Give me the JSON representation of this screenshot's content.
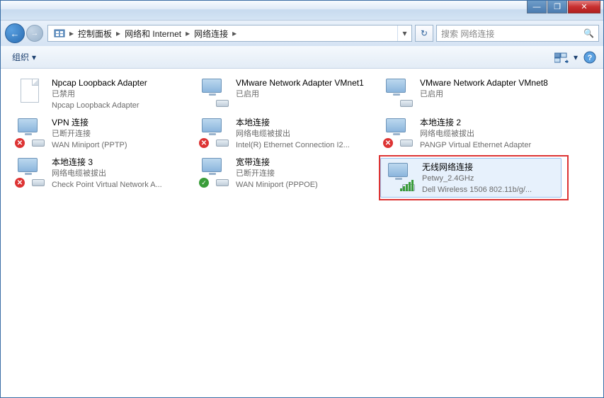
{
  "titlebar": {
    "minimize": "—",
    "maximize": "❐",
    "close": "✕"
  },
  "navbar": {
    "back_glyph": "←",
    "forward_glyph": "→",
    "crumbs": [
      {
        "label": "控制面板"
      },
      {
        "label": "网络和 Internet"
      },
      {
        "label": "网络连接"
      }
    ],
    "refresh_glyph": "↻",
    "search_placeholder": "搜索 网络连接"
  },
  "toolbar": {
    "organize_label": "组织",
    "dropdown_glyph": "▾"
  },
  "connections": [
    {
      "name": "Npcap Loopback Adapter",
      "status": "已禁用",
      "device": "Npcap Loopback Adapter",
      "icon": "doc",
      "overlay": "none",
      "selected": false
    },
    {
      "name": "VMware Network Adapter VMnet1",
      "status": "已启用",
      "device": "",
      "icon": "net",
      "overlay": "none",
      "selected": false
    },
    {
      "name": "VMware Network Adapter VMnet8",
      "status": "已启用",
      "device": "",
      "icon": "net",
      "overlay": "none",
      "selected": false
    },
    {
      "name": "VPN 连接",
      "status": "已断开连接",
      "device": "WAN Miniport (PPTP)",
      "icon": "net",
      "overlay": "x",
      "selected": false
    },
    {
      "name": "本地连接",
      "status": "网络电缆被拔出",
      "device": "Intel(R) Ethernet Connection I2...",
      "icon": "net",
      "overlay": "x",
      "selected": false
    },
    {
      "name": "本地连接 2",
      "status": "网络电缆被拔出",
      "device": "PANGP Virtual Ethernet Adapter",
      "icon": "net",
      "overlay": "x",
      "selected": false
    },
    {
      "name": "本地连接 3",
      "status": "网络电缆被拔出",
      "device": "Check Point Virtual Network A...",
      "icon": "net",
      "overlay": "x",
      "selected": false
    },
    {
      "name": "宽带连接",
      "status": "已断开连接",
      "device": "WAN Miniport (PPPOE)",
      "icon": "net",
      "overlay": "ok",
      "selected": false
    },
    {
      "name": "无线网络连接",
      "status": "Petwy_2.4GHz",
      "device": "Dell Wireless 1506 802.11b/g/...",
      "icon": "wifi",
      "overlay": "none",
      "selected": true,
      "highlighted": true
    }
  ]
}
